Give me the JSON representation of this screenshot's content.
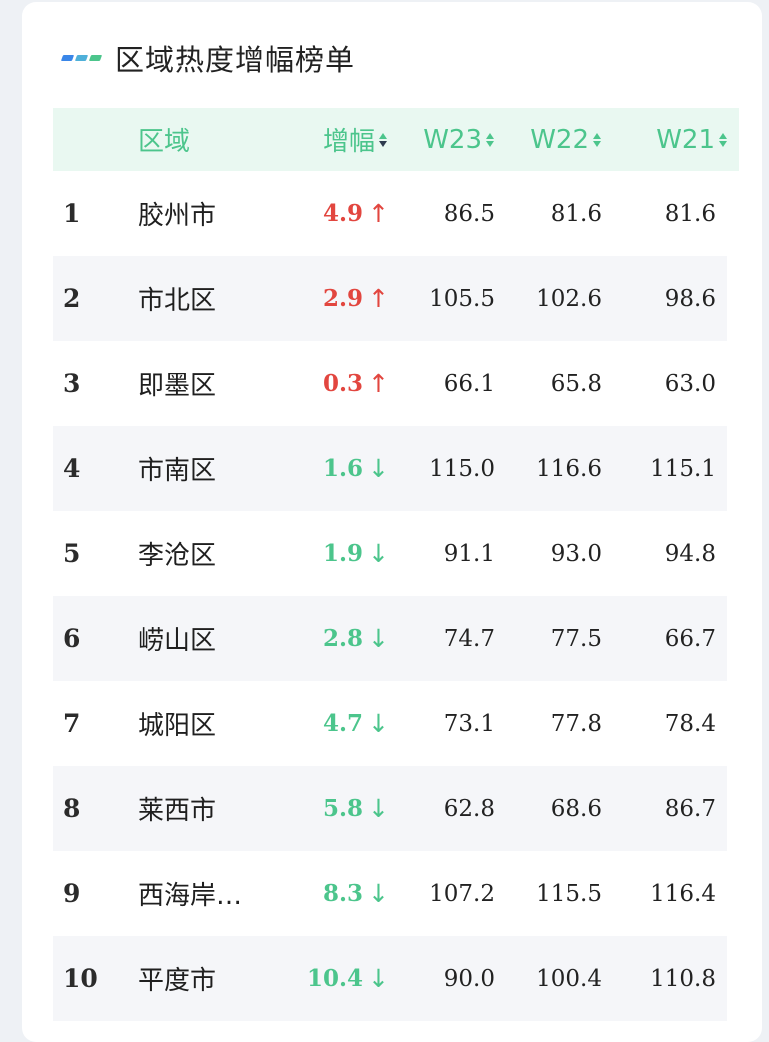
{
  "title": "区域热度增幅榜单",
  "colors": {
    "accent_green": "#4cc58c",
    "up_red": "#e2463f",
    "header_bg": "#e9f8f1",
    "mark": [
      "#3a86e8",
      "#4fb0d9",
      "#4cc58c"
    ]
  },
  "header": {
    "region": "区域",
    "delta": "增幅",
    "w23": "W23",
    "w22": "W22",
    "w21": "W21"
  },
  "rows": [
    {
      "rank": "1",
      "name": "胶州市",
      "delta": "4.9",
      "dir": "up",
      "arrow": "↑",
      "w23": "86.5",
      "w22": "81.6",
      "w21": "81.6"
    },
    {
      "rank": "2",
      "name": "市北区",
      "delta": "2.9",
      "dir": "up",
      "arrow": "↑",
      "w23": "105.5",
      "w22": "102.6",
      "w21": "98.6"
    },
    {
      "rank": "3",
      "name": "即墨区",
      "delta": "0.3",
      "dir": "up",
      "arrow": "↑",
      "w23": "66.1",
      "w22": "65.8",
      "w21": "63.0"
    },
    {
      "rank": "4",
      "name": "市南区",
      "delta": "1.6",
      "dir": "down",
      "arrow": "↓",
      "w23": "115.0",
      "w22": "116.6",
      "w21": "115.1"
    },
    {
      "rank": "5",
      "name": "李沧区",
      "delta": "1.9",
      "dir": "down",
      "arrow": "↓",
      "w23": "91.1",
      "w22": "93.0",
      "w21": "94.8"
    },
    {
      "rank": "6",
      "name": "崂山区",
      "delta": "2.8",
      "dir": "down",
      "arrow": "↓",
      "w23": "74.7",
      "w22": "77.5",
      "w21": "66.7"
    },
    {
      "rank": "7",
      "name": "城阳区",
      "delta": "4.7",
      "dir": "down",
      "arrow": "↓",
      "w23": "73.1",
      "w22": "77.8",
      "w21": "78.4"
    },
    {
      "rank": "8",
      "name": "莱西市",
      "delta": "5.8",
      "dir": "down",
      "arrow": "↓",
      "w23": "62.8",
      "w22": "68.6",
      "w21": "86.7"
    },
    {
      "rank": "9",
      "name": "西海岸…",
      "delta": "8.3",
      "dir": "down",
      "arrow": "↓",
      "w23": "107.2",
      "w22": "115.5",
      "w21": "116.4"
    },
    {
      "rank": "10",
      "name": "平度市",
      "delta": "10.4",
      "dir": "down",
      "arrow": "↓",
      "w23": "90.0",
      "w22": "100.4",
      "w21": "110.8"
    }
  ]
}
